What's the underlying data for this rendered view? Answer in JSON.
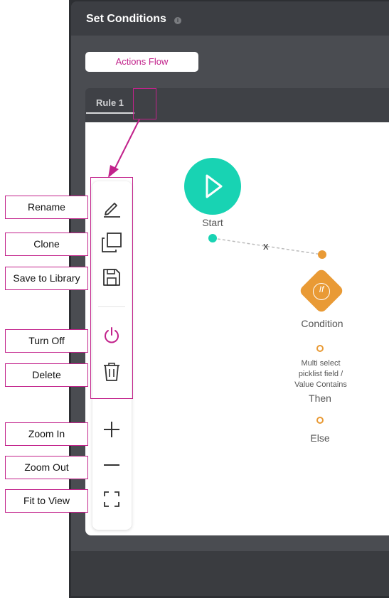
{
  "dialog": {
    "title": "Set Conditions",
    "info_icon": "info-icon"
  },
  "tabs": {
    "actions_flow": "Actions Flow",
    "rule": "Rule 1"
  },
  "toolbar": {
    "items": [
      "pencil-icon",
      "copy-icon",
      "save-icon",
      "power-icon",
      "trash-icon",
      "plus-icon",
      "minus-icon",
      "fit-icon"
    ],
    "accent": "#c2228b"
  },
  "callouts": {
    "rename": "Rename",
    "clone": "Clone",
    "save_to_library": "Save to Library",
    "turn_off": "Turn Off",
    "delete": "Delete",
    "zoom_in": "Zoom In",
    "zoom_out": "Zoom Out",
    "fit_to_view": "Fit to View"
  },
  "flow": {
    "start_label": "Start",
    "connector_marker": "x",
    "condition_icon_text": "If",
    "condition_label": "Condition",
    "condition_desc": "Multi select picklist field / Value Contains",
    "then_label": "Then",
    "else_label": "Else",
    "start_color": "#18d3b3",
    "condition_color": "#e99a35"
  }
}
